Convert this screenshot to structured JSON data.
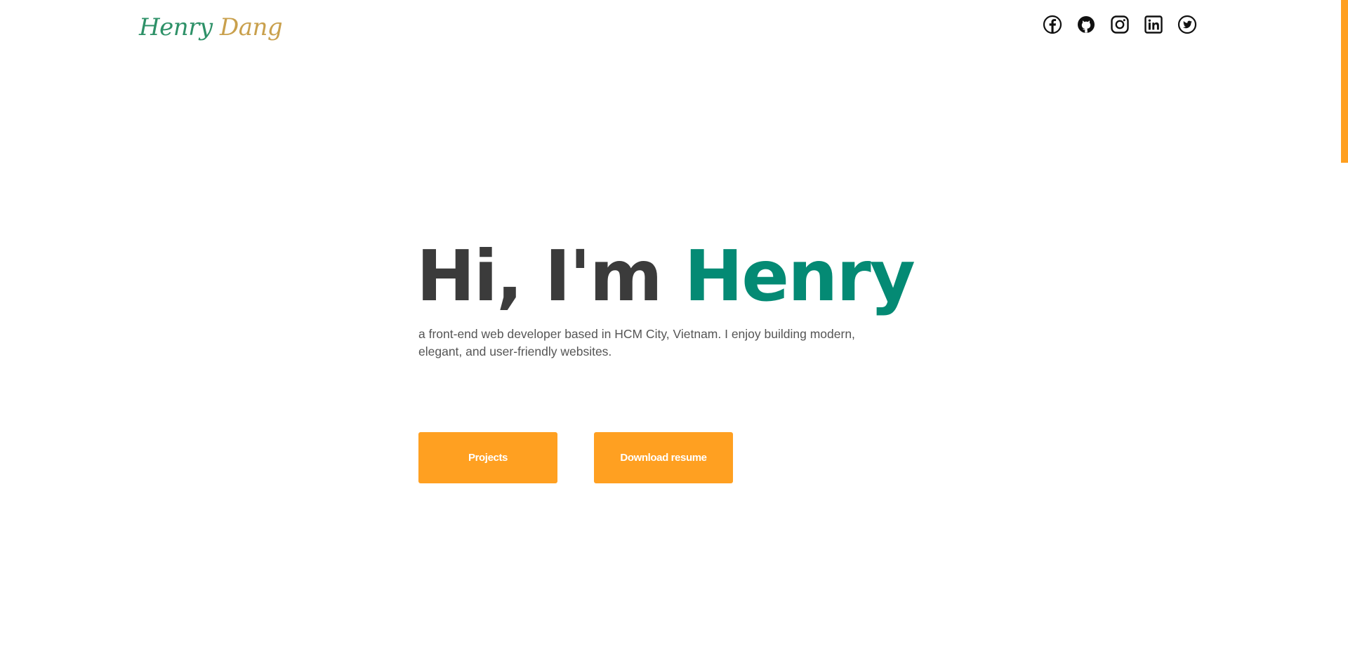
{
  "header": {
    "logo_first": "Henry",
    "logo_last": "Dang",
    "social_links": [
      {
        "icon": "facebook-icon"
      },
      {
        "icon": "github-icon"
      },
      {
        "icon": "instagram-icon"
      },
      {
        "icon": "linkedin-icon"
      },
      {
        "icon": "twitter-icon"
      }
    ]
  },
  "hero": {
    "title_prefix": "Hi, I'm ",
    "title_name": "Henry",
    "description": "a front-end web developer based in HCM City, Vietnam. I enjoy building modern, elegant, and user-friendly websites."
  },
  "actions": {
    "projects_label": "Projects",
    "resume_label": "Download resume"
  },
  "colors": {
    "accent": "#ffa021",
    "name_green": "#048a74",
    "heading": "#3b3b3b",
    "logo_green": "#2e9168",
    "logo_gold": "#c9a04c"
  }
}
